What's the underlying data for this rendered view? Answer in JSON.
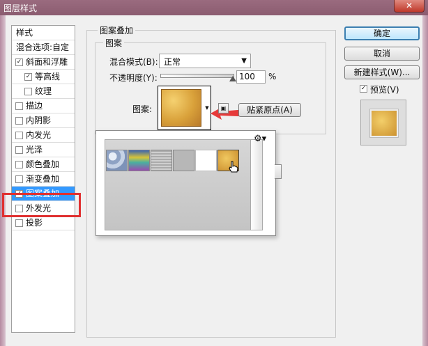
{
  "window": {
    "title": "图层样式",
    "close_label": "✕"
  },
  "styles_panel": {
    "header": "样式",
    "blend_options": "混合选项:自定",
    "items": [
      {
        "label": "斜面和浮雕",
        "checked": true,
        "indent": false
      },
      {
        "label": "等高线",
        "checked": true,
        "indent": true
      },
      {
        "label": "纹理",
        "checked": false,
        "indent": true
      },
      {
        "label": "描边",
        "checked": false,
        "indent": false
      },
      {
        "label": "内阴影",
        "checked": false,
        "indent": false
      },
      {
        "label": "内发光",
        "checked": false,
        "indent": false
      },
      {
        "label": "光泽",
        "checked": false,
        "indent": false
      },
      {
        "label": "颜色叠加",
        "checked": false,
        "indent": false
      },
      {
        "label": "渐变叠加",
        "checked": false,
        "indent": false
      },
      {
        "label": "图案叠加",
        "checked": true,
        "indent": false,
        "selected": true
      },
      {
        "label": "外发光",
        "checked": false,
        "indent": false
      },
      {
        "label": "投影",
        "checked": false,
        "indent": false
      }
    ]
  },
  "overlay": {
    "group_title": "图案叠加",
    "subgroup_title": "图案",
    "blend_mode_label": "混合模式(B):",
    "blend_mode_value": "正常",
    "opacity_label": "不透明度(Y):",
    "opacity_value": "100",
    "opacity_unit": "%",
    "opacity_level": 1.0,
    "pattern_label": "图案:",
    "snap_button": "贴紧原点(A)"
  },
  "pattern_picker": {
    "gear_icon": "gear-icon"
  },
  "actions": {
    "ok": "确定",
    "cancel": "取消",
    "new_style": "新建样式(W)...",
    "preview_label": "预览(V)",
    "preview_checked": true
  },
  "colors": {
    "accent": "#3399ff",
    "highlight_box": "#e03030",
    "title_bar": "#8b5c70"
  }
}
